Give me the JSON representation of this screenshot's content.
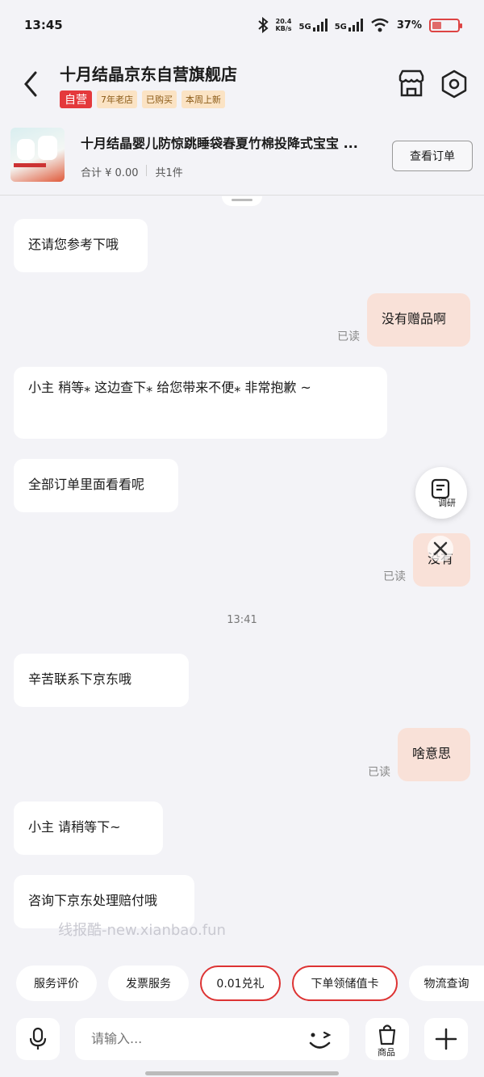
{
  "status_bar": {
    "time": "13:45",
    "net_speed": "20.4",
    "net_unit": "KB/s",
    "sim1": "5G",
    "sim2": "5G",
    "battery": "37%",
    "battery_level": 0.37
  },
  "header": {
    "shop_name": "十月结晶京东自营旗舰店",
    "tags": [
      "自营",
      "7年老店",
      "已购买",
      "本周上新"
    ]
  },
  "product": {
    "title": "十月结晶婴儿防惊跳睡袋春夏竹棉投降式宝宝 ...",
    "total": "合计 ¥ 0.00",
    "count": "共1件",
    "order_button": "查看订单"
  },
  "messages": [
    {
      "dir": "in",
      "text": "还请您参考下哦"
    },
    {
      "dir": "out",
      "text": "没有赠品啊",
      "read": "已读"
    },
    {
      "dir": "in",
      "text": "小主  稍等⁎ 这边查下⁎ 给您带来不便⁎ 非常抱歉 ~"
    },
    {
      "dir": "in",
      "text": "全部订单里面看看呢"
    },
    {
      "dir": "out",
      "text": "没有",
      "read": "已读"
    },
    {
      "dir": "in",
      "text": "辛苦联系下京东哦"
    },
    {
      "dir": "out",
      "text": "啥意思",
      "read": "已读"
    },
    {
      "dir": "in",
      "text": "小主   请稍等下~"
    },
    {
      "dir": "in",
      "text": "咨询下京东处理赔付哦"
    }
  ],
  "timestamp": "13:41",
  "survey_label": "调研",
  "watermark": "线报酷-new.xianbao.fun",
  "quick_actions": [
    "服务评价",
    "发票服务",
    "0.01兑礼",
    "下单领储值卡",
    "物流查询"
  ],
  "input": {
    "placeholder": "请输入..."
  },
  "goods_label": "商品",
  "colors": {
    "accent": "#e4393c",
    "outgoing_bubble": "#f9e1d8",
    "background": "#f3f3f7"
  },
  "icons": [
    "back-arrow-icon",
    "store-icon",
    "settings-icon",
    "survey-icon",
    "close-icon",
    "mic-icon",
    "emoji-icon",
    "shopping-bag-icon",
    "plus-icon"
  ]
}
